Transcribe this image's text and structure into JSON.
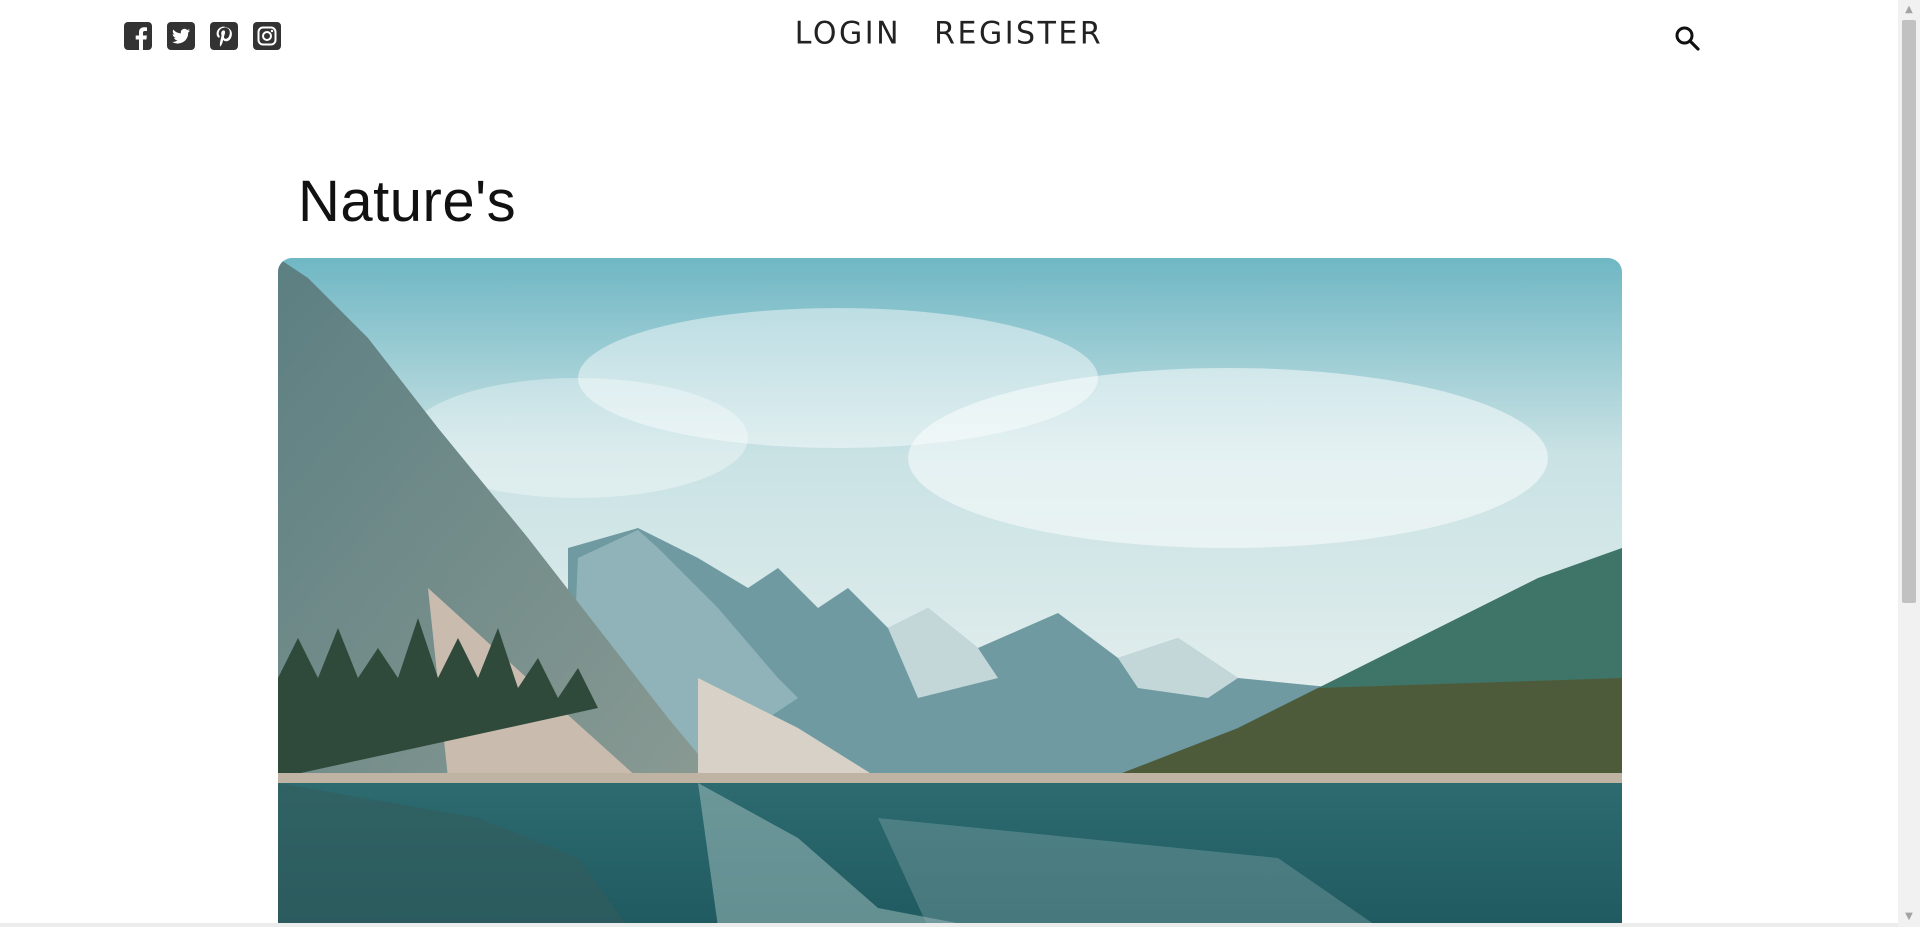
{
  "header": {
    "social_icons": [
      "facebook-icon",
      "twitter-icon",
      "pinterest-icon",
      "instagram-icon"
    ],
    "nav": {
      "login_label": "LOGIN",
      "register_label": "REGISTER"
    },
    "search_icon": "search-icon"
  },
  "main": {
    "title": "Nature's",
    "hero_image": "mountain-lake-landscape"
  },
  "colors": {
    "icon": "#333333",
    "text": "#111111",
    "background": "#ffffff"
  }
}
